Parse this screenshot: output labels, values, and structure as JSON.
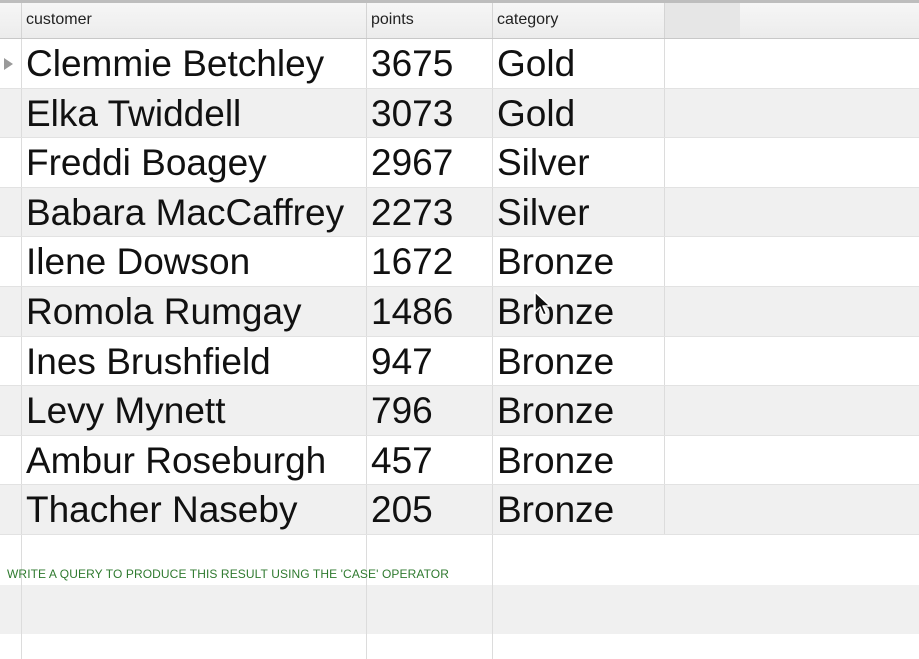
{
  "table": {
    "columns": [
      "customer",
      "points",
      "category"
    ],
    "rows": [
      {
        "customer": "Clemmie Betchley",
        "points": "3675",
        "category": "Gold"
      },
      {
        "customer": "Elka Twiddell",
        "points": "3073",
        "category": "Gold"
      },
      {
        "customer": "Freddi Boagey",
        "points": "2967",
        "category": "Silver"
      },
      {
        "customer": "Babara MacCaffrey",
        "points": "2273",
        "category": "Silver"
      },
      {
        "customer": "Ilene Dowson",
        "points": "1672",
        "category": "Bronze"
      },
      {
        "customer": "Romola Rumgay",
        "points": "1486",
        "category": "Bronze"
      },
      {
        "customer": "Ines Brushfield",
        "points": "947",
        "category": "Bronze"
      },
      {
        "customer": "Levy Mynett",
        "points": "796",
        "category": "Bronze"
      },
      {
        "customer": "Ambur Roseburgh",
        "points": "457",
        "category": "Bronze"
      },
      {
        "customer": "Thacher Naseby",
        "points": "205",
        "category": "Bronze"
      }
    ]
  },
  "note": {
    "text": "WRITE A QUERY TO PRODUCE THIS RESULT USING THE 'CASE' OPERATOR",
    "color": "#2f7a2f"
  },
  "icons": {
    "current_row_marker": "triangle-right-icon",
    "pointer": "mouse-pointer-icon"
  }
}
